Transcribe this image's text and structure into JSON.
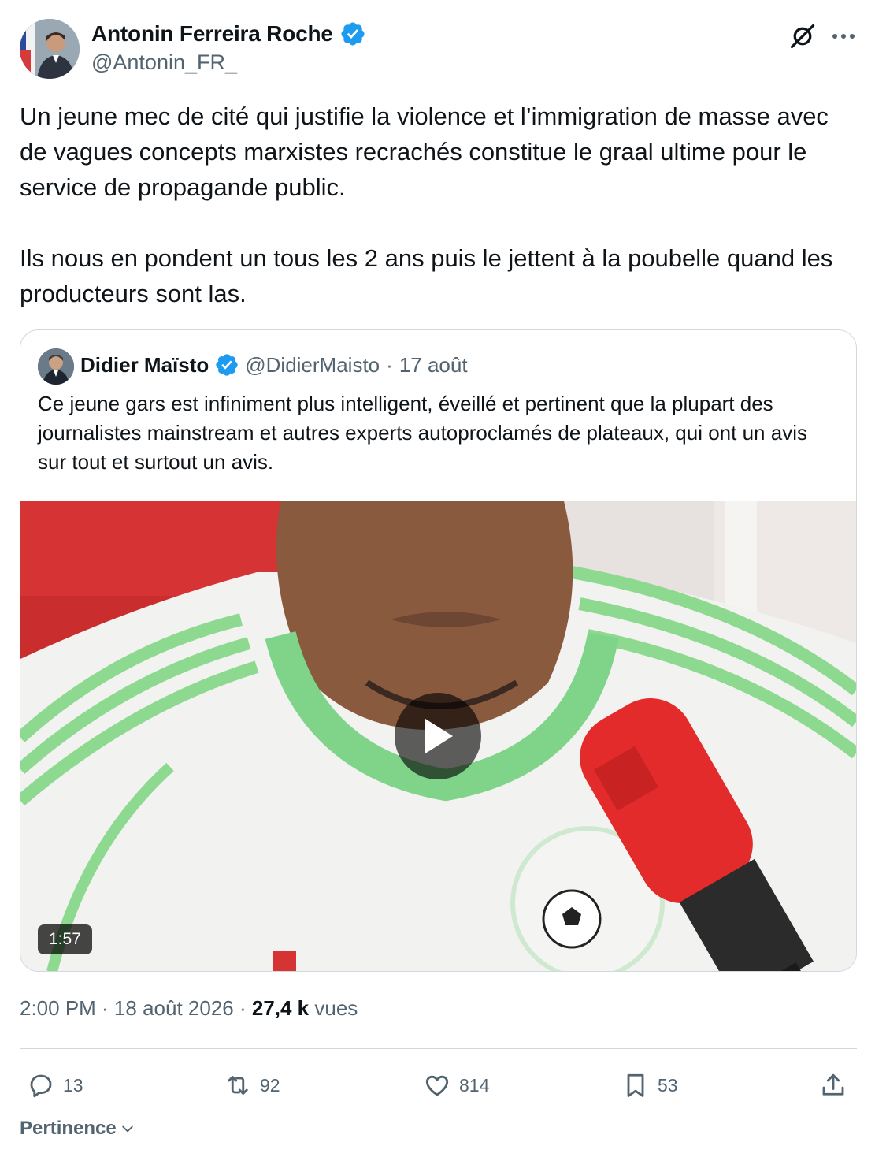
{
  "post": {
    "author_name": "Antonin Ferreira Roche",
    "author_handle": "@Antonin_FR_",
    "paragraphs": [
      "Un jeune mec de cité qui justifie la violence et l’immigration de masse avec de vagues concepts marxistes recrachés constitue le graal ultime pour le service de propagande public.",
      "Ils nous en pondent un tous les 2 ans puis le jettent à la poubelle quand les producteurs sont las."
    ],
    "timestamp": "2:00 PM · 18 août 2026 · ",
    "views_count": "27,4 k",
    "views_label": " vues"
  },
  "quote": {
    "author_name": "Didier Maïsto",
    "author_handle": "@DidierMaisto",
    "separator": "·",
    "date": "17 août",
    "text": "Ce jeune gars est infiniment plus intelligent, éveillé et pertinent que la plupart des journalistes mainstream et autres experts autoproclamés de plateaux, qui ont un avis sur tout et surtout un avis.",
    "video_duration": "1:57"
  },
  "actions": {
    "replies": "13",
    "reposts": "92",
    "likes": "814",
    "bookmarks": "53"
  },
  "sort_label": "Pertinence",
  "icons": [
    "grok-icon",
    "more-icon",
    "verified-icon",
    "play-icon",
    "reply-icon",
    "repost-icon",
    "like-icon",
    "bookmark-icon",
    "share-icon",
    "chevron-down-icon"
  ],
  "colors": {
    "text": "#0f1419",
    "secondary": "#536471",
    "verified": "#1d9bf0",
    "border": "#cfd9de"
  }
}
